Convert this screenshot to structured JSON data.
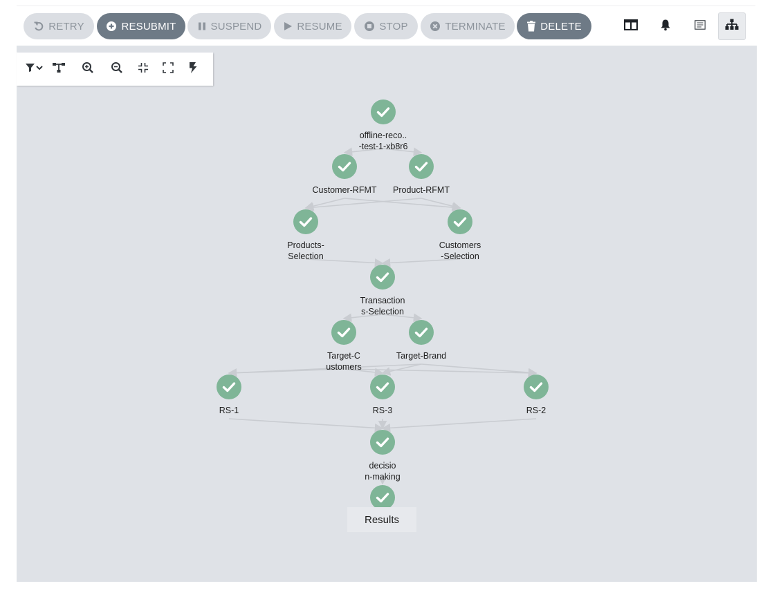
{
  "toolbar": {
    "buttons": [
      {
        "id": "retry",
        "label": "RETRY",
        "icon": "retry-icon",
        "state": "disabled"
      },
      {
        "id": "resubmit",
        "label": "RESUBMIT",
        "icon": "plus-circle-icon",
        "state": "active"
      },
      {
        "id": "suspend",
        "label": "SUSPEND",
        "icon": "pause-icon",
        "state": "disabled"
      },
      {
        "id": "resume",
        "label": "RESUME",
        "icon": "play-icon",
        "state": "disabled"
      },
      {
        "id": "stop",
        "label": "STOP",
        "icon": "stop-circle-icon",
        "state": "disabled"
      },
      {
        "id": "terminate",
        "label": "TERMINATE",
        "icon": "times-circle-icon",
        "state": "disabled"
      },
      {
        "id": "delete",
        "label": "DELETE",
        "icon": "trash-icon",
        "state": "active"
      }
    ],
    "right_icons": [
      "columns-icon",
      "bell-icon",
      "list-icon",
      "sitemap-icon"
    ],
    "selected_view": "sitemap-icon"
  },
  "graph_tools": [
    "filter-dropdown-icon",
    "hierarchy-icon",
    "zoom-in-icon",
    "zoom-out-icon",
    "collapse-icon",
    "expand-icon",
    "lightning-icon"
  ],
  "graph": {
    "nodes": [
      {
        "id": "root",
        "label": "offline-reco..\n-test-1-xb8r6",
        "status": "succeeded"
      },
      {
        "id": "customer-rfmt",
        "label": "Customer-RFMT",
        "status": "succeeded"
      },
      {
        "id": "product-rfmt",
        "label": "Product-RFMT",
        "status": "succeeded"
      },
      {
        "id": "products-selection",
        "label": "Products-\nSelection",
        "status": "succeeded"
      },
      {
        "id": "customers-selection",
        "label": "Customers\n-Selection",
        "status": "succeeded"
      },
      {
        "id": "transactions-selection",
        "label": "Transaction\ns-Selection",
        "status": "succeeded"
      },
      {
        "id": "target-customers",
        "label": "Target-C\nustomers",
        "status": "succeeded"
      },
      {
        "id": "target-brand",
        "label": "Target-Brand",
        "status": "succeeded"
      },
      {
        "id": "rs-1",
        "label": "RS-1",
        "status": "succeeded"
      },
      {
        "id": "rs-3",
        "label": "RS-3",
        "status": "succeeded"
      },
      {
        "id": "rs-2",
        "label": "RS-2",
        "status": "succeeded"
      },
      {
        "id": "decision-making",
        "label": "decisio\nn-making",
        "status": "succeeded"
      },
      {
        "id": "results",
        "label": "Results",
        "status": "succeeded"
      }
    ],
    "edges": [
      [
        "root",
        "customer-rfmt"
      ],
      [
        "root",
        "product-rfmt"
      ],
      [
        "customer-rfmt",
        "products-selection"
      ],
      [
        "customer-rfmt",
        "customers-selection"
      ],
      [
        "product-rfmt",
        "products-selection"
      ],
      [
        "product-rfmt",
        "customers-selection"
      ],
      [
        "products-selection",
        "transactions-selection"
      ],
      [
        "customers-selection",
        "transactions-selection"
      ],
      [
        "transactions-selection",
        "target-customers"
      ],
      [
        "transactions-selection",
        "target-brand"
      ],
      [
        "target-customers",
        "rs-1"
      ],
      [
        "target-customers",
        "rs-3"
      ],
      [
        "target-customers",
        "rs-2"
      ],
      [
        "target-brand",
        "rs-1"
      ],
      [
        "target-brand",
        "rs-3"
      ],
      [
        "target-brand",
        "rs-2"
      ],
      [
        "rs-1",
        "decision-making"
      ],
      [
        "rs-3",
        "decision-making"
      ],
      [
        "rs-2",
        "decision-making"
      ],
      [
        "decision-making",
        "results"
      ]
    ]
  },
  "colors": {
    "node_success": "#7fb597",
    "edge": "#c9ccd1",
    "canvas_bg": "#dfe2e7",
    "button_active": "#6e7a86",
    "button_disabled": "#dbdee3"
  }
}
